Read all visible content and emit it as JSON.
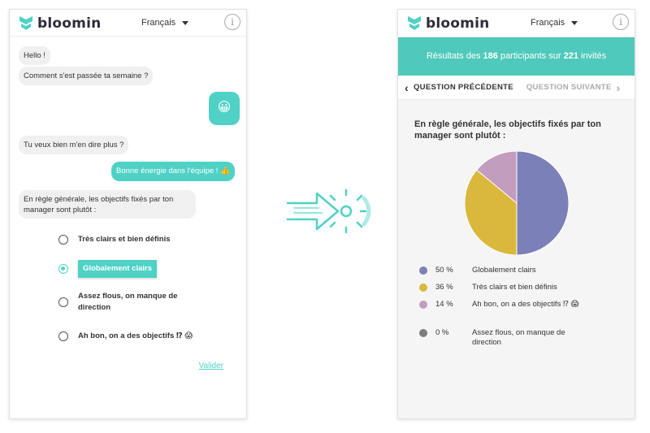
{
  "app": {
    "name": "bloomin",
    "language": "Français",
    "info_icon": "i"
  },
  "chat": {
    "messages": [
      {
        "from": "bot",
        "text": "Hello !"
      },
      {
        "from": "bot",
        "text": "Comment s'est passée ta semaine ?"
      },
      {
        "from": "user",
        "text": "😀"
      },
      {
        "from": "bot",
        "text": "Tu veux bien m'en dire plus ?"
      },
      {
        "from": "user",
        "text": "Bonne énergie dans l'équipe ! 👍"
      },
      {
        "from": "bot",
        "text": "En règle générale, les objectifs fixés par ton manager sont plutôt :"
      }
    ],
    "options": [
      {
        "label": "Très clairs et bien définis",
        "selected": false
      },
      {
        "label": "Globalement clairs",
        "selected": true
      },
      {
        "label": "Assez flous, on manque de direction",
        "selected": false
      },
      {
        "label": "Ah bon, on a des objectifs ⁉ 😱",
        "selected": false
      }
    ],
    "submit_label": "Valider"
  },
  "results": {
    "banner_prefix": "Résultats des ",
    "participants": "186",
    "banner_middle": " participants sur ",
    "invited": "221",
    "banner_suffix": " invités",
    "prev_label": "QUESTION PRÉCÉDENTE",
    "next_label": "QUESTION SUIVANTE",
    "question": "En règle générale, les objectifs fixés par ton manager sont plutôt :"
  },
  "chart_data": {
    "type": "pie",
    "slices": [
      {
        "label": "Globalement clairs",
        "value": 50,
        "pct_text": "50 %",
        "color": "#7b80b8"
      },
      {
        "label": "Très clairs et bien définis",
        "value": 36,
        "pct_text": "36 %",
        "color": "#d9b83b"
      },
      {
        "label": "Ah bon, on a des objectifs ⁉ 😱",
        "value": 14,
        "pct_text": "14 %",
        "color": "#c29dbd"
      },
      {
        "label": "Assez flous, on manque de direction",
        "value": 0,
        "pct_text": "0 %",
        "color": "#7d7d7d"
      }
    ]
  },
  "colors": {
    "accent": "#4fd2c5",
    "banner": "#4fc9bb"
  }
}
